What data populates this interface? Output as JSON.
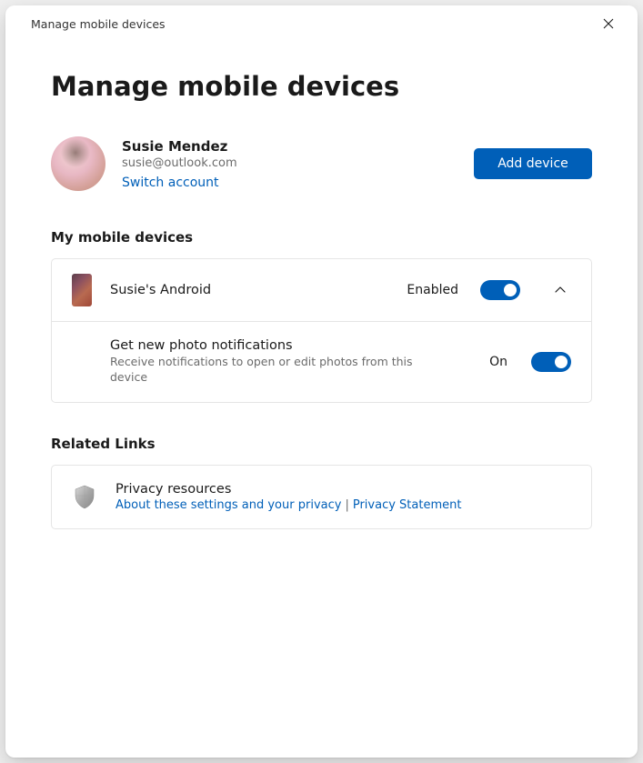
{
  "titlebar": {
    "title": "Manage mobile devices"
  },
  "page": {
    "title": "Manage mobile devices"
  },
  "account": {
    "name": "Susie Mendez",
    "email": "susie@outlook.com",
    "switch_label": "Switch account",
    "add_device_label": "Add device"
  },
  "devices": {
    "section_title": "My mobile devices",
    "item": {
      "name": "Susie's Android",
      "status_label": "Enabled"
    },
    "setting": {
      "title": "Get new photo notifications",
      "description": "Receive notifications to open or edit photos from this device",
      "status_label": "On"
    }
  },
  "related": {
    "section_title": "Related Links",
    "privacy_title": "Privacy resources",
    "about_link": "About these settings and your privacy",
    "statement_link": "Privacy Statement"
  }
}
